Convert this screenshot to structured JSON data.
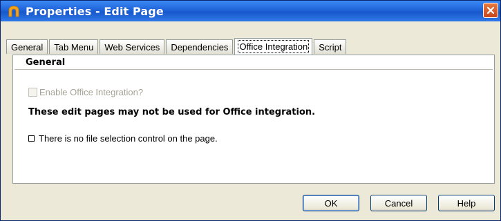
{
  "window": {
    "title": "Properties - Edit Page"
  },
  "tabs": [
    {
      "label": "General"
    },
    {
      "label": "Tab Menu"
    },
    {
      "label": "Web Services"
    },
    {
      "label": "Dependencies"
    },
    {
      "label": "Office Integration"
    },
    {
      "label": "Script"
    }
  ],
  "active_tab": "Office Integration",
  "panel": {
    "section_title": "General",
    "enable_checkbox": {
      "label": "Enable Office Integration?",
      "checked": false,
      "disabled": true
    },
    "warning": "These edit pages may not be used for Office integration.",
    "reason": "There is no file selection control on the page."
  },
  "buttons": {
    "ok": "OK",
    "cancel": "Cancel",
    "help": "Help"
  },
  "colors": {
    "titlebar": "#1f63d9",
    "close_button": "#d2532a",
    "window_bg": "#ece9d8",
    "disabled_text": "#a5a395",
    "app_icon": "#f5a21b"
  },
  "icons": {
    "app": "app-logo-icon",
    "close": "close-icon"
  }
}
